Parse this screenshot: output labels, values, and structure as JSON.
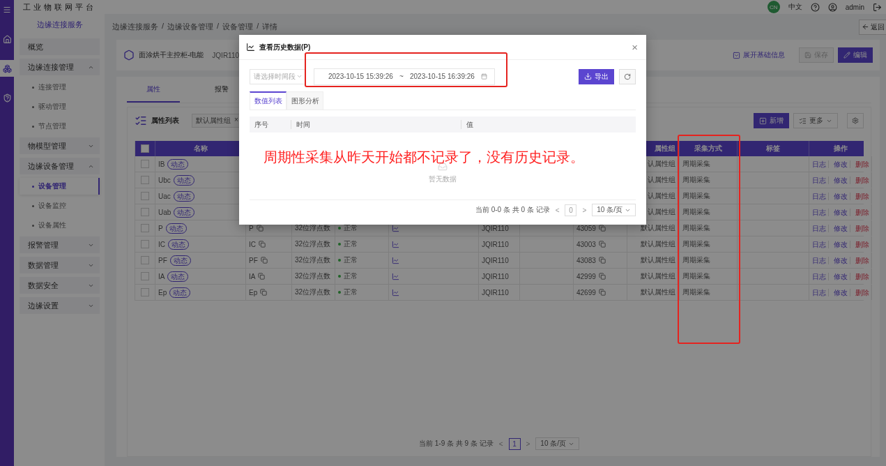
{
  "topbar": {
    "avatar": "CN",
    "language": "中文",
    "user": "admin"
  },
  "sidebar": {
    "logo": "工业物联网平台",
    "title": "边缘连接服务",
    "items": [
      {
        "label": "概览",
        "selected": false
      },
      {
        "label": "边缘连接管理",
        "selected": false,
        "expanded": true,
        "children": [
          {
            "label": "连接管理",
            "selected": false
          },
          {
            "label": "驱动管理",
            "selected": false
          },
          {
            "label": "节点管理",
            "selected": false
          }
        ]
      },
      {
        "label": "物模型管理",
        "selected": false,
        "expanded": false
      },
      {
        "label": "边缘设备管理",
        "selected": false,
        "expanded": true,
        "children": [
          {
            "label": "设备管理",
            "selected": true
          },
          {
            "label": "设备监控",
            "selected": false
          },
          {
            "label": "设备属性",
            "selected": false
          }
        ]
      },
      {
        "label": "报警管理",
        "selected": false,
        "expanded": false
      },
      {
        "label": "数据管理",
        "selected": false,
        "expanded": false
      },
      {
        "label": "数据安全",
        "selected": false,
        "expanded": false
      },
      {
        "label": "边缘设置",
        "selected": false,
        "expanded": false
      }
    ]
  },
  "breadcrumb": {
    "items": [
      "边缘连接服务",
      "边缘设备管理",
      "设备管理",
      "详情"
    ],
    "separator": "/"
  },
  "back_button": "返回",
  "device": {
    "name": "面涂烘干主控柜-电能",
    "code": "JQIR110",
    "expand_label": "展开基础信息",
    "save": {
      "label": "保存",
      "disabled": true
    },
    "edit": "编辑"
  },
  "tabs": [
    {
      "label": "属性",
      "selected": true
    },
    {
      "label": "报警",
      "selected": false
    }
  ],
  "toolbar": {
    "title": "属性列表",
    "tag": "默认属性组",
    "tag_close": "×",
    "add": "新增",
    "more": "更多"
  },
  "table": {
    "all_checked": false,
    "header": {
      "name": "名称",
      "group": "属性组",
      "method": "采集方式",
      "tags": "标签",
      "actions": "操作"
    },
    "rows": [
      {
        "checked": false,
        "name": "IB",
        "badge": "动态",
        "group": "认属性组",
        "method": "周期采集",
        "actions": [
          {
            "label": "日志",
            "kind": "link"
          },
          {
            "label": "修改",
            "kind": "link"
          },
          {
            "label": "删除",
            "kind": "danger"
          }
        ]
      },
      {
        "checked": false,
        "name": "Ubc",
        "badge": "动态",
        "group": "认属性组",
        "method": "周期采集",
        "actions": [
          {
            "label": "日志",
            "kind": "link"
          },
          {
            "label": "修改",
            "kind": "link"
          },
          {
            "label": "删除",
            "kind": "danger"
          }
        ]
      },
      {
        "checked": false,
        "name": "Uac",
        "badge": "动态",
        "group": "认属性组",
        "method": "周期采集",
        "actions": [
          {
            "label": "日志",
            "kind": "link"
          },
          {
            "label": "修改",
            "kind": "link"
          },
          {
            "label": "删除",
            "kind": "danger"
          }
        ]
      },
      {
        "checked": false,
        "name": "Uab",
        "badge": "动态",
        "group": "认属性组",
        "method": "周期采集",
        "actions": [
          {
            "label": "日志",
            "kind": "link"
          },
          {
            "label": "修改",
            "kind": "link"
          },
          {
            "label": "删除",
            "kind": "danger"
          }
        ]
      },
      {
        "checked": false,
        "name": "P",
        "badge": "动态",
        "ident": "P",
        "type": "32位浮点数",
        "status": "正常",
        "device": "JQIR110",
        "address": "43059",
        "group": "默认属性组",
        "method": "周期采集",
        "actions": [
          {
            "label": "日志",
            "kind": "link"
          },
          {
            "label": "修改",
            "kind": "link"
          },
          {
            "label": "删除",
            "kind": "danger"
          }
        ]
      },
      {
        "checked": false,
        "name": "IC",
        "badge": "动态",
        "ident": "IC",
        "type": "32位浮点数",
        "status": "正常",
        "device": "JQIR110",
        "address": "43003",
        "group": "默认属性组",
        "method": "周期采集",
        "actions": [
          {
            "label": "日志",
            "kind": "link"
          },
          {
            "label": "修改",
            "kind": "link"
          },
          {
            "label": "删除",
            "kind": "danger"
          }
        ]
      },
      {
        "checked": false,
        "name": "PF",
        "badge": "动态",
        "ident": "PF",
        "type": "32位浮点数",
        "status": "正常",
        "device": "JQIR110",
        "address": "43083",
        "group": "默认属性组",
        "method": "周期采集",
        "actions": [
          {
            "label": "日志",
            "kind": "link"
          },
          {
            "label": "修改",
            "kind": "link"
          },
          {
            "label": "删除",
            "kind": "danger"
          }
        ]
      },
      {
        "checked": false,
        "name": "IA",
        "badge": "动态",
        "ident": "IA",
        "type": "32位浮点数",
        "status": "正常",
        "device": "JQIR110",
        "address": "42999",
        "group": "默认属性组",
        "method": "周期采集",
        "actions": [
          {
            "label": "日志",
            "kind": "link"
          },
          {
            "label": "修改",
            "kind": "link"
          },
          {
            "label": "删除",
            "kind": "danger"
          }
        ]
      },
      {
        "checked": false,
        "name": "Ep",
        "badge": "动态",
        "ident": "Ep",
        "type": "32位浮点数",
        "status": "正常",
        "device": "JQIR110",
        "address": "42699",
        "group": "默认属性组",
        "method": "周期采集",
        "actions": [
          {
            "label": "日志",
            "kind": "link"
          },
          {
            "label": "修改",
            "kind": "link"
          },
          {
            "label": "删除",
            "kind": "danger"
          }
        ]
      }
    ]
  },
  "pagination": {
    "summary": "当前 1-9 条 共 9 条 记录",
    "prev": "<",
    "page": "1",
    "next": ">",
    "page_size": "10 条/页"
  },
  "dialog": {
    "title": "查看历史数据(P)",
    "close": "×",
    "period_placeholder": "请选择时间段",
    "start": "2023-10-15 15:39:26",
    "separator": "~",
    "end": "2023-10-15 16:39:26",
    "export": "导出",
    "tabs": [
      {
        "label": "数值列表",
        "selected": true
      },
      {
        "label": "图形分析",
        "selected": false
      }
    ],
    "columns": [
      "序号",
      "时间",
      "值"
    ],
    "empty": "暂无数据",
    "pagination": {
      "summary": "当前 0-0 条 共 0 条 记录",
      "prev": "<",
      "page": "0",
      "next": ">",
      "page_size": "10 条/页"
    }
  },
  "annotation": {
    "note": "周期性采集从昨天开始都不记录了，没有历史记录。"
  }
}
